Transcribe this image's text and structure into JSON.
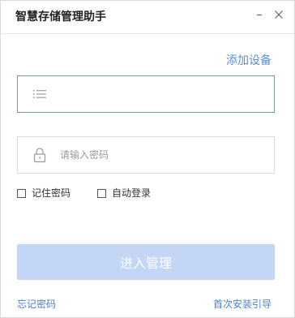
{
  "window": {
    "title": "智慧存储管理助手"
  },
  "controls": {
    "minimize_icon": "minimize-icon",
    "close_icon": "close-icon"
  },
  "header": {
    "add_device_label": "添加设备"
  },
  "form": {
    "device": {
      "icon": "list-icon",
      "value": "",
      "placeholder": ""
    },
    "password": {
      "icon": "lock-icon",
      "value": "",
      "placeholder": "请输入密码"
    },
    "remember_password": {
      "label": "记住密码",
      "checked": false
    },
    "auto_login": {
      "label": "自动登录",
      "checked": false
    },
    "submit_label": "进入管理"
  },
  "footer": {
    "forgot_password_label": "忘记密码",
    "install_guide_label": "首次安装引导"
  },
  "colors": {
    "accent": "#5b8fd6",
    "button_disabled": "#c4d6f6",
    "active_border": "#7aa1a8"
  }
}
